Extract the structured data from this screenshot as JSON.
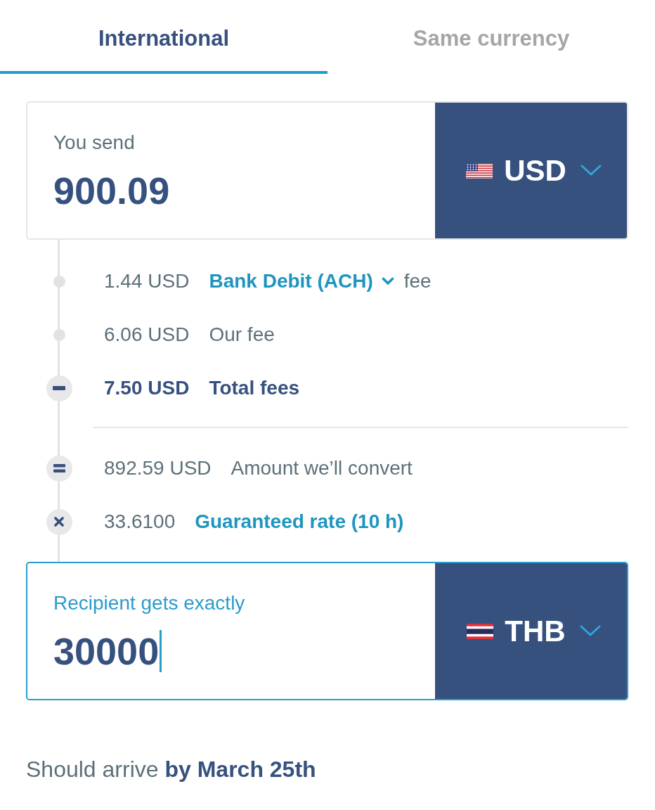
{
  "tabs": [
    {
      "label": "International",
      "selected": true
    },
    {
      "label": "Same currency",
      "selected": false
    }
  ],
  "send": {
    "label": "You send",
    "value": "900.09",
    "currency": "USD",
    "flag": {
      "kind": "us"
    },
    "focused": false
  },
  "fees": [
    {
      "kind": "dot",
      "amount": "1.44 USD",
      "label": "Bank Debit (ACH)",
      "link": true,
      "dropdown": true,
      "suffix": "fee",
      "emphasis": false
    },
    {
      "kind": "dot",
      "amount": "6.06 USD",
      "label": "Our fee",
      "link": false,
      "dropdown": false,
      "emphasis": false
    },
    {
      "kind": "minus",
      "amount": "7.50 USD",
      "label": "Total fees",
      "link": false,
      "dropdown": false,
      "emphasis": true
    }
  ],
  "conversion": [
    {
      "kind": "equals",
      "amount": "892.59 USD",
      "label": "Amount we’ll convert",
      "link": false,
      "dropdown": false,
      "emphasis": false
    },
    {
      "kind": "times",
      "amount": "33.6100",
      "label": "Guaranteed rate (10 h)",
      "link": true,
      "dropdown": false,
      "emphasis": false
    }
  ],
  "receive": {
    "label": "Recipient gets exactly",
    "value": "30000",
    "currency": "THB",
    "flag": {
      "kind": "th"
    },
    "focused": true
  },
  "arrival": "Should arrive **by March 25th**"
}
